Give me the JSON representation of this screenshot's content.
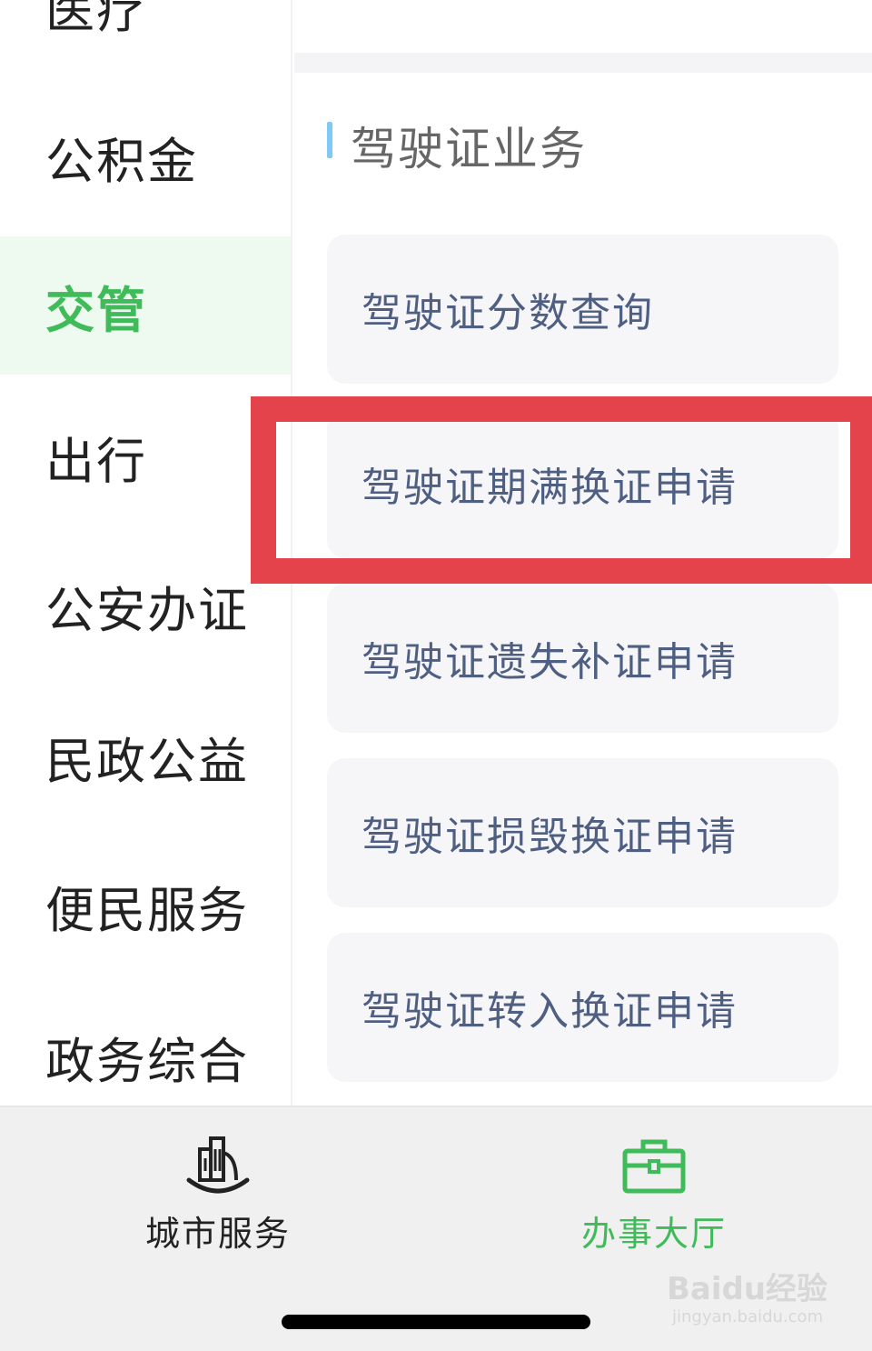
{
  "sidebar": {
    "items": [
      {
        "label": "医疗"
      },
      {
        "label": "公积金"
      },
      {
        "label": "交管"
      },
      {
        "label": "出行"
      },
      {
        "label": "公安办证"
      },
      {
        "label": "民政公益"
      },
      {
        "label": "便民服务"
      },
      {
        "label": "政务综合"
      }
    ]
  },
  "main": {
    "section_title": "驾驶证业务",
    "services": [
      {
        "label": "驾驶证分数查询"
      },
      {
        "label": "驾驶证期满换证申请"
      },
      {
        "label": "驾驶证遗失补证申请"
      },
      {
        "label": "驾驶证损毁换证申请"
      },
      {
        "label": "驾驶证转入换证申请"
      }
    ]
  },
  "tabbar": {
    "tabs": [
      {
        "label": "城市服务",
        "icon": "city-building-icon"
      },
      {
        "label": "办事大厅",
        "icon": "briefcase-icon"
      }
    ]
  },
  "watermark": {
    "main": "Baidu经验",
    "sub": "jingyan.baidu.com"
  },
  "colors": {
    "accent_green": "#3fbb5a",
    "active_bg": "#eef9f0",
    "highlight_red": "#e4434b",
    "section_bar_blue": "#7ec9f5",
    "service_text": "#4e5f82"
  }
}
